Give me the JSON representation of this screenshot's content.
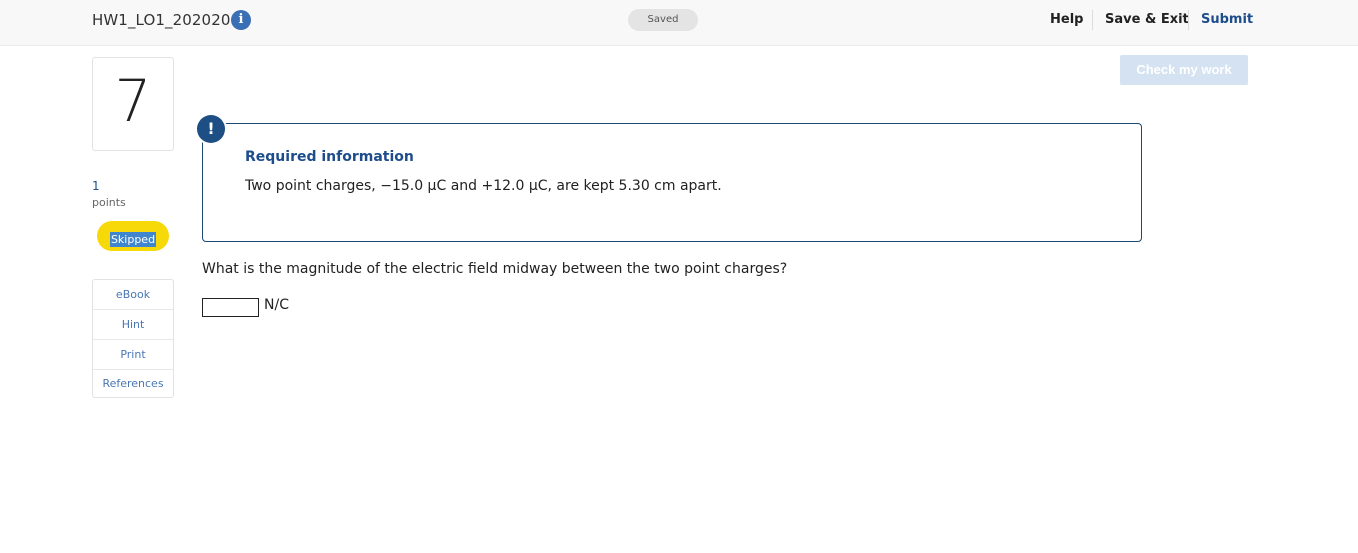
{
  "header": {
    "assignment_title": "HW1_LO1_202020",
    "info_icon_glyph": "i",
    "save_status": "Saved",
    "help_label": "Help",
    "save_exit_label": "Save & Exit",
    "submit_label": "Submit"
  },
  "toolbar": {
    "check_my_work_label": "Check my work"
  },
  "question": {
    "number": "7",
    "points_value": "1",
    "points_label": "points",
    "status": "Skipped",
    "text": "What is the magnitude of the electric field midway between the two point charges?",
    "answer_value": "",
    "unit": "N/C"
  },
  "tools": {
    "items": [
      {
        "label": "eBook"
      },
      {
        "label": "Hint"
      },
      {
        "label": "Print"
      },
      {
        "label": "References"
      }
    ]
  },
  "required_info": {
    "icon_glyph": "!",
    "heading": "Required information",
    "body": "Two point charges, −15.0 μC and +12.0 μC, are kept 5.30 cm apart."
  },
  "colors": {
    "brand_blue": "#1e4d8c",
    "status_yellow": "#f7d809",
    "check_button_disabled": "#d5e2f1"
  }
}
